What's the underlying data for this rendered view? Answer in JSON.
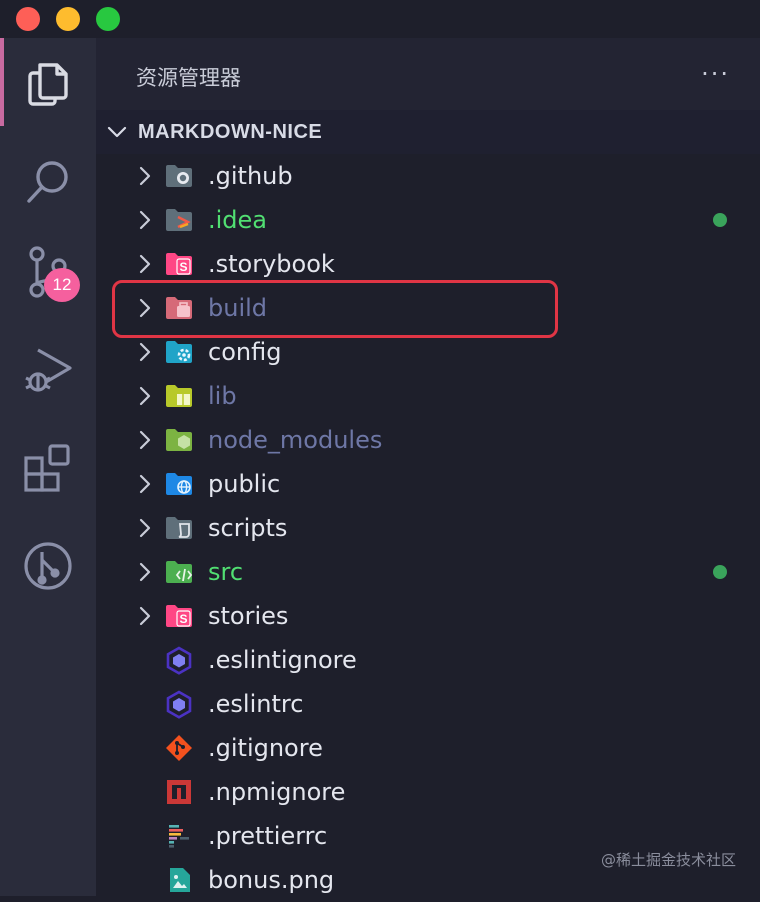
{
  "window": {
    "controls": [
      "close",
      "minimize",
      "maximize"
    ]
  },
  "activity_bar": {
    "items": [
      {
        "name": "explorer-icon",
        "active": true
      },
      {
        "name": "search-icon"
      },
      {
        "name": "source-control-icon",
        "badge": "12"
      },
      {
        "name": "run-debug-icon"
      },
      {
        "name": "extensions-icon"
      },
      {
        "name": "git-graph-icon"
      }
    ]
  },
  "sidebar": {
    "title": "资源管理器",
    "more_label": "···",
    "section_title": "MARKDOWN-NICE"
  },
  "tree": [
    {
      "label": ".github",
      "type": "folder",
      "icon": "folder-github-icon",
      "status": "normal"
    },
    {
      "label": ".idea",
      "type": "folder",
      "icon": "folder-idea-icon",
      "status": "modified"
    },
    {
      "label": ".storybook",
      "type": "folder",
      "icon": "folder-storybook-icon",
      "status": "normal"
    },
    {
      "label": "build",
      "type": "folder",
      "icon": "folder-build-icon",
      "status": "ignored"
    },
    {
      "label": "config",
      "type": "folder",
      "icon": "folder-config-icon",
      "status": "normal"
    },
    {
      "label": "lib",
      "type": "folder",
      "icon": "folder-lib-icon",
      "status": "ignored"
    },
    {
      "label": "node_modules",
      "type": "folder",
      "icon": "folder-node-icon",
      "status": "ignored"
    },
    {
      "label": "public",
      "type": "folder",
      "icon": "folder-public-icon",
      "status": "normal"
    },
    {
      "label": "scripts",
      "type": "folder",
      "icon": "folder-scripts-icon",
      "status": "normal"
    },
    {
      "label": "src",
      "type": "folder",
      "icon": "folder-src-icon",
      "status": "modified"
    },
    {
      "label": "stories",
      "type": "folder",
      "icon": "folder-stories-icon",
      "status": "normal"
    },
    {
      "label": ".eslintignore",
      "type": "file",
      "icon": "eslint-icon",
      "status": "normal"
    },
    {
      "label": ".eslintrc",
      "type": "file",
      "icon": "eslint-icon",
      "status": "normal"
    },
    {
      "label": ".gitignore",
      "type": "file",
      "icon": "git-icon",
      "status": "normal"
    },
    {
      "label": ".npmignore",
      "type": "file",
      "icon": "npm-icon",
      "status": "normal"
    },
    {
      "label": ".prettierrc",
      "type": "file",
      "icon": "prettier-icon",
      "status": "normal"
    },
    {
      "label": "bonus.png",
      "type": "file",
      "icon": "image-file-icon",
      "status": "normal"
    }
  ],
  "highlight_target": "build",
  "watermark": "@稀土掘金技术社区",
  "colors": {
    "background": "#1e1f2b",
    "activity_bar": "#2a2c3b",
    "modified_text": "#51df72",
    "ignored_text": "#6e77a6",
    "badge": "#f5609e",
    "highlight_box": "#e03545"
  }
}
